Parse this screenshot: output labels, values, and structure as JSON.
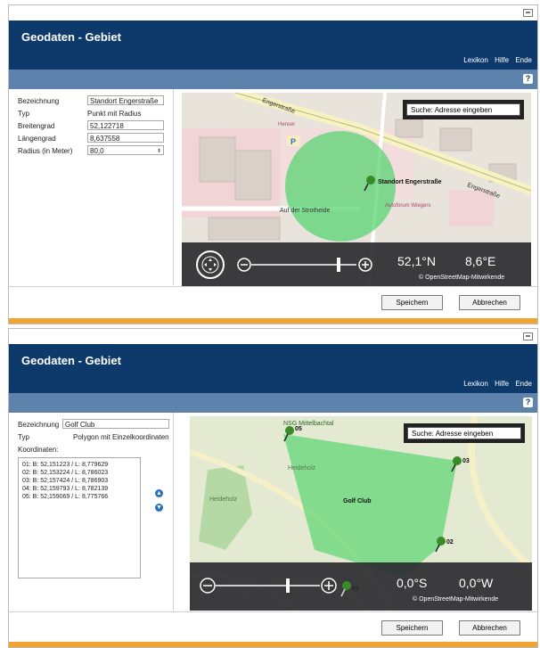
{
  "window1": {
    "title": "Geodaten - Gebiet",
    "menu": [
      "Lexikon",
      "Hilfe",
      "Ende"
    ],
    "form": {
      "bezeichnung_label": "Bezeichnung",
      "bezeichnung_value": "Standort Engerstraße",
      "typ_label": "Typ",
      "typ_value": "Punkt mit Radius",
      "breitengrad_label": "Breitengrad",
      "breitengrad_value": "52,122718",
      "laengengrad_label": "Längengrad",
      "laengengrad_value": "8,637558",
      "radius_label": "Radius (in Meter)",
      "radius_value": "80,0"
    },
    "map": {
      "search_placeholder": "Suche: Adresse eingeben",
      "lat": "52,1°N",
      "lon": "8,6°E",
      "copyright": "© OpenStreetMap-Mitwirkende",
      "pin_label": "Standort Engerstraße",
      "street_labels": [
        "Engerstraße",
        "Auf der Strotheide",
        "Engerstraße"
      ],
      "poi_labels": [
        "Hensel",
        "Autoforum Wiegers"
      ]
    },
    "buttons": {
      "save": "Speichern",
      "cancel": "Abbrechen"
    }
  },
  "window2": {
    "title": "Geodaten - Gebiet",
    "menu": [
      "Lexikon",
      "Hilfe",
      "Ende"
    ],
    "form": {
      "bezeichnung_label": "Bezeichnung",
      "bezeichnung_value": "Golf Club",
      "typ_label": "Typ",
      "typ_value": "Polygon mit Einzelkoordinaten",
      "koordinaten_label": "Koordinaten:",
      "koordinaten": [
        "01: B: 52,151223 / L: 8,779629",
        "02: B: 52,153224 / L: 8,786023",
        "03: B: 52,157424 / L: 8,786903",
        "04: B: 52,159793 / L: 8,782139",
        "05: B: 52,159069 / L: 8,775766"
      ]
    },
    "map": {
      "search_placeholder": "Suche: Adresse eingeben",
      "lat": "0,0°S",
      "lon": "0,0°W",
      "copyright": "© OpenStreetMap-Mitwirkende",
      "area_label": "Golf Club",
      "top_label": "NSG Mittelbachtal",
      "marker_labels": [
        "01",
        "02",
        "03",
        "05"
      ],
      "place_labels": [
        "Heideholz",
        "Heideholz"
      ]
    },
    "buttons": {
      "save": "Speichern",
      "cancel": "Abbrechen"
    }
  },
  "colors": {
    "header": "#0e3a6b",
    "subbar": "#5d82ab",
    "accent": "#f0a431",
    "circle": "#4fd36a"
  }
}
